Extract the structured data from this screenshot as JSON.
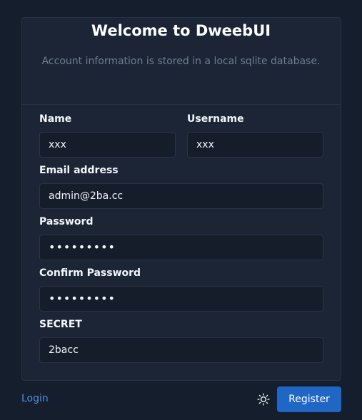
{
  "header": {
    "title": "Welcome to DweebUI",
    "subtitle": "Account information is stored in a local sqlite database."
  },
  "form": {
    "name": {
      "label": "Name",
      "value": "xxx"
    },
    "username": {
      "label": "Username",
      "value": "xxx"
    },
    "email": {
      "label": "Email address",
      "value": "admin@2ba.cc"
    },
    "password": {
      "label": "Password",
      "value": "•••••••••"
    },
    "confirm_password": {
      "label": "Confirm Password",
      "value": "•••••••••"
    },
    "secret": {
      "label": "SECRET",
      "value": "2bacc"
    }
  },
  "footer": {
    "login_label": "Login",
    "theme_icon": "sun-icon",
    "register_label": "Register"
  },
  "colors": {
    "background": "#151e2c",
    "card": "#1b2536",
    "accent": "#2066c5",
    "link": "#4d8de0"
  }
}
